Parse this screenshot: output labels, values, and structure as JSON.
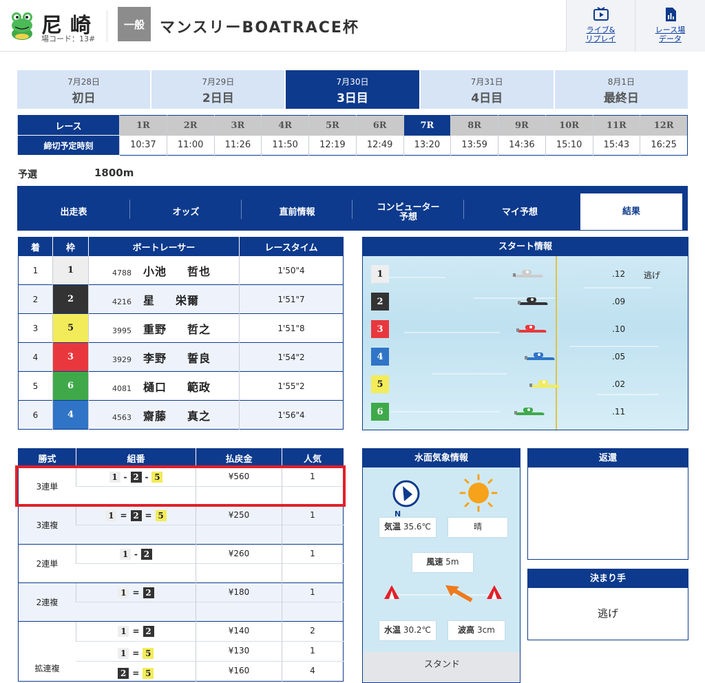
{
  "header": {
    "venue": "尼崎",
    "venue_code": "場コード：13#",
    "grade": "一般",
    "title": "マンスリーBOATRACE杯",
    "live_label_1": "ライブ&",
    "live_label_2": "リプレイ",
    "data_label_1": "レース場",
    "data_label_2": "データ"
  },
  "days": [
    {
      "date": "7月28日",
      "name": "初日"
    },
    {
      "date": "7月29日",
      "name": "2日目"
    },
    {
      "date": "7月30日",
      "name": "3日目"
    },
    {
      "date": "7月31日",
      "name": "4日目"
    },
    {
      "date": "8月1日",
      "name": "最終日"
    }
  ],
  "races": {
    "race_header": "レース",
    "time_header": "締切予定時刻",
    "numbers": [
      "1R",
      "2R",
      "3R",
      "4R",
      "5R",
      "6R",
      "7R",
      "8R",
      "9R",
      "10R",
      "11R",
      "12R"
    ],
    "times": [
      "10:37",
      "11:00",
      "11:26",
      "11:50",
      "12:19",
      "12:49",
      "13:20",
      "13:59",
      "14:36",
      "15:10",
      "15:43",
      "16:25"
    ],
    "current": "7R"
  },
  "race_info": {
    "type": "予選",
    "distance": "1800m"
  },
  "menu": [
    "出走表",
    "オッズ",
    "直前情報",
    "コンピューター予想",
    "マイ予想",
    "結果"
  ],
  "menu_comp_1": "コンピューター",
  "menu_comp_2": "予想",
  "results": {
    "headers": [
      "着",
      "枠",
      "ボートレーサー",
      "レースタイム"
    ],
    "rows": [
      {
        "pos": "1",
        "frame": "1",
        "reg": "4788",
        "last": "小池",
        "first": "哲也",
        "time": "1'50\"4"
      },
      {
        "pos": "2",
        "frame": "2",
        "reg": "4216",
        "last": "星",
        "first": "栄爾",
        "time": "1'51\"7"
      },
      {
        "pos": "3",
        "frame": "5",
        "reg": "3995",
        "last": "重野",
        "first": "哲之",
        "time": "1'51\"8"
      },
      {
        "pos": "4",
        "frame": "3",
        "reg": "3929",
        "last": "李野",
        "first": "誓良",
        "time": "1'54\"2"
      },
      {
        "pos": "5",
        "frame": "6",
        "reg": "4081",
        "last": "樋口",
        "first": "範政",
        "time": "1'55\"2"
      },
      {
        "pos": "6",
        "frame": "4",
        "reg": "4563",
        "last": "齋藤",
        "first": "真之",
        "time": "1'56\"4"
      }
    ]
  },
  "start_info": {
    "title": "スタート情報",
    "rows": [
      {
        "course": "1",
        "st": ".12",
        "kimarite": "逃げ"
      },
      {
        "course": "2",
        "st": ".09",
        "kimarite": ""
      },
      {
        "course": "3",
        "st": ".10",
        "kimarite": ""
      },
      {
        "course": "4",
        "st": ".05",
        "kimarite": ""
      },
      {
        "course": "5",
        "st": ".02",
        "kimarite": ""
      },
      {
        "course": "6",
        "st": ".11",
        "kimarite": ""
      }
    ]
  },
  "payout": {
    "headers": [
      "勝式",
      "組番",
      "払戻金",
      "人気"
    ],
    "rows": [
      {
        "type": "3連単",
        "combos": [
          {
            "nums": [
              "1",
              "2",
              "5"
            ],
            "op": "-",
            "amount": "¥560",
            "pop": "1"
          }
        ]
      },
      {
        "type": "3連複",
        "combos": [
          {
            "nums": [
              "1",
              "2",
              "5"
            ],
            "op": "=",
            "amount": "¥250",
            "pop": "1"
          }
        ]
      },
      {
        "type": "2連単",
        "combos": [
          {
            "nums": [
              "1",
              "2"
            ],
            "op": "-",
            "amount": "¥260",
            "pop": "1"
          }
        ]
      },
      {
        "type": "2連複",
        "combos": [
          {
            "nums": [
              "1",
              "2"
            ],
            "op": "=",
            "amount": "¥180",
            "pop": "1"
          }
        ]
      },
      {
        "type": "拡連複",
        "combos": [
          {
            "nums": [
              "1",
              "2"
            ],
            "op": "=",
            "amount": "¥140",
            "pop": "2"
          },
          {
            "nums": [
              "1",
              "5"
            ],
            "op": "=",
            "amount": "¥130",
            "pop": "1"
          },
          {
            "nums": [
              "2",
              "5"
            ],
            "op": "=",
            "amount": "¥160",
            "pop": "4"
          }
        ]
      }
    ]
  },
  "weather": {
    "title": "水面気象情報",
    "compass_label": "N",
    "temp_label": "気温",
    "temp": "35.6℃",
    "weather": "晴",
    "wind_label": "風速",
    "wind": "5m",
    "water_label": "水温",
    "water_temp": "30.2℃",
    "wave_label": "波高",
    "wave": "3cm",
    "stand": "スタンド"
  },
  "refund": {
    "title": "返還",
    "value": ""
  },
  "kimarite": {
    "title": "決まり手",
    "value": "逃げ"
  },
  "frame_colors": {
    "1": "#eeeeee",
    "2": "#333333",
    "3": "#e8383d",
    "4": "#2f74c6",
    "5": "#f3ec5a",
    "6": "#3fa94a"
  },
  "frame_text": {
    "1": "#222222",
    "2": "#ffffff",
    "3": "#ffffff",
    "4": "#ffffff",
    "5": "#222222",
    "6": "#ffffff"
  },
  "accent": "#0d3a8c"
}
